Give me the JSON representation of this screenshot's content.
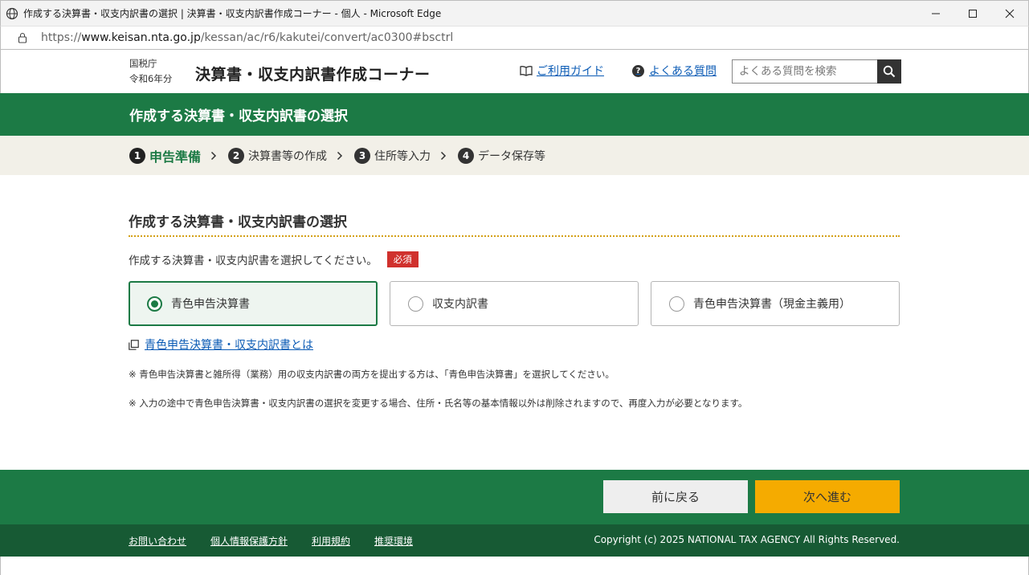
{
  "window": {
    "title": "作成する決算書・収支内訳書の選択 | 決算書・収支内訳書作成コーナー - 個人 - Microsoft Edge"
  },
  "address": {
    "scheme": "https://",
    "host": "www.keisan.nta.go.jp",
    "path": "/kessan/ac/r6/kakutei/convert/ac0300#bsctrl"
  },
  "header": {
    "agency": "国税庁",
    "year": "令和6年分",
    "title": "決算書・収支内訳書作成コーナー",
    "guide_label": "ご利用ガイド",
    "faq_label": "よくある質問",
    "search_placeholder": "よくある質問を検索"
  },
  "section": {
    "title": "作成する決算書・収支内訳書の選択"
  },
  "steps": [
    {
      "num": "1",
      "label": "申告準備",
      "active": true
    },
    {
      "num": "2",
      "label": "決算書等の作成",
      "active": false
    },
    {
      "num": "3",
      "label": "住所等入力",
      "active": false
    },
    {
      "num": "4",
      "label": "データ保存等",
      "active": false
    }
  ],
  "main": {
    "heading": "作成する決算書・収支内訳書の選択",
    "prompt": "作成する決算書・収支内訳書を選択してください。",
    "required_badge": "必須",
    "options": [
      {
        "label": "青色申告決算書",
        "selected": true
      },
      {
        "label": "収支内訳書",
        "selected": false
      },
      {
        "label": "青色申告決算書（現金主義用）",
        "selected": false
      }
    ],
    "about_link": "青色申告決算書・収支内訳書とは",
    "note1": "※ 青色申告決算書と雑所得（業務）用の収支内訳書の両方を提出する方は、「青色申告決算書」を選択してください。",
    "note2": "※ 入力の途中で青色申告決算書・収支内訳書の選択を変更する場合、住所・氏名等の基本情報以外は削除されますので、再度入力が必要となります。"
  },
  "footer": {
    "back_label": "前に戻る",
    "next_label": "次へ進む",
    "links": [
      "お問い合わせ",
      "個人情報保護方針",
      "利用規約",
      "推奨環境"
    ],
    "copyright": "Copyright (c) 2025 NATIONAL TAX AGENCY All Rights Reserved."
  },
  "colors": {
    "brand_green": "#1c7a45",
    "dark_green": "#175a34",
    "next_button": "#f5ab00",
    "required": "#d0312d",
    "link": "#0b5bb5"
  }
}
